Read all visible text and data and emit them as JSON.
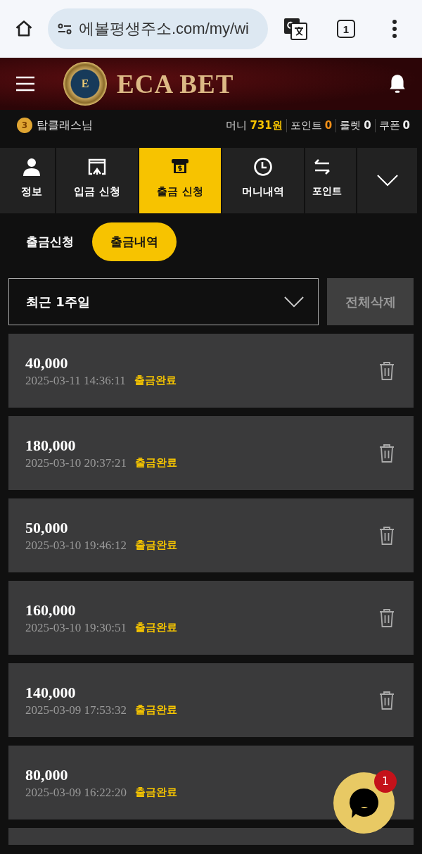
{
  "browser": {
    "url": "에볼평생주소.com/my/wi",
    "tab_count": "1"
  },
  "header": {
    "emblem_letter": "E",
    "brand": "ECA BET"
  },
  "user_bar": {
    "level": "3",
    "user": "탑클래스님",
    "stats": [
      {
        "label": "머니",
        "value": "731원",
        "kind": "money"
      },
      {
        "label": "포인트",
        "value": "0",
        "kind": "point"
      },
      {
        "label": "룰렛",
        "value": "0",
        "kind": "plain"
      },
      {
        "label": "쿠폰",
        "value": "0",
        "kind": "plain"
      }
    ]
  },
  "tabs": [
    {
      "label": "정보",
      "kind": "person",
      "selected": false
    },
    {
      "label": "입금 신청",
      "kind": "deposit",
      "selected": false
    },
    {
      "label": "출금 신청",
      "kind": "atm",
      "selected": true
    },
    {
      "label": "머니내역",
      "kind": "clock",
      "selected": false
    },
    {
      "label": "포인트",
      "kind": "swap",
      "selected": false
    }
  ],
  "sub_tabs": [
    {
      "label": "출금신청",
      "selected": false
    },
    {
      "label": "출금내역",
      "selected": true
    }
  ],
  "filter": {
    "period": "최근 1주일",
    "delete_all": "전체삭제"
  },
  "records": [
    {
      "amount": "40,000",
      "datetime": "2025-03-11 14:36:11",
      "status": "출금완료",
      "delete_icon": true
    },
    {
      "amount": "180,000",
      "datetime": "2025-03-10 20:37:21",
      "status": "출금완료",
      "delete_icon": true
    },
    {
      "amount": "50,000",
      "datetime": "2025-03-10 19:46:12",
      "status": "출금완료",
      "delete_icon": true
    },
    {
      "amount": "160,000",
      "datetime": "2025-03-10 19:30:51",
      "status": "출금완료",
      "delete_icon": true
    },
    {
      "amount": "140,000",
      "datetime": "2025-03-09 17:53:32",
      "status": "출금완료",
      "delete_icon": true
    },
    {
      "amount": "80,000",
      "datetime": "2025-03-09 16:22:20",
      "status": "출금완료",
      "delete_icon": false
    }
  ],
  "chat": {
    "badge": "1"
  }
}
